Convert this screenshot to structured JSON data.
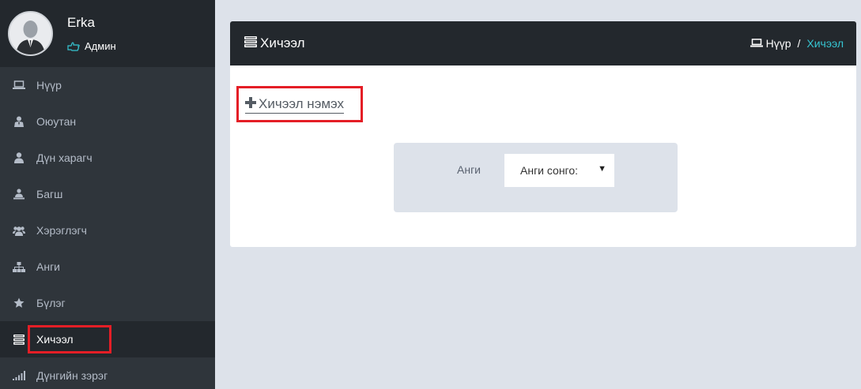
{
  "profile": {
    "name": "Erka",
    "role": "Админ"
  },
  "sidebar": {
    "items": [
      {
        "label": "Нүүр",
        "icon": "laptop-icon"
      },
      {
        "label": "Оюутан",
        "icon": "user-tie-icon"
      },
      {
        "label": "Дүн харагч",
        "icon": "user-icon"
      },
      {
        "label": "Багш",
        "icon": "teacher-icon"
      },
      {
        "label": "Хэрэглэгч",
        "icon": "users-icon"
      },
      {
        "label": "Анги",
        "icon": "sitemap-icon"
      },
      {
        "label": "Бүлэг",
        "icon": "star-icon"
      },
      {
        "label": "Хичээл",
        "icon": "stack-icon",
        "active": true
      },
      {
        "label": "Дүнгийн зэрэг",
        "icon": "signal-bars-icon"
      }
    ]
  },
  "panel": {
    "title": "Хичээл",
    "breadcrumb": {
      "home": "Нүүр",
      "separator": "/",
      "current": "Хичээл"
    },
    "add_label": "Хичээл нэмэх",
    "filter": {
      "label": "Анги",
      "select_value": "Анги сонго:"
    }
  },
  "colors": {
    "sidebar_bg": "#2f353b",
    "header_bg": "#23282d",
    "accent": "#36c6d3",
    "highlight_border": "#e41e26",
    "page_bg": "#dde2ea"
  }
}
